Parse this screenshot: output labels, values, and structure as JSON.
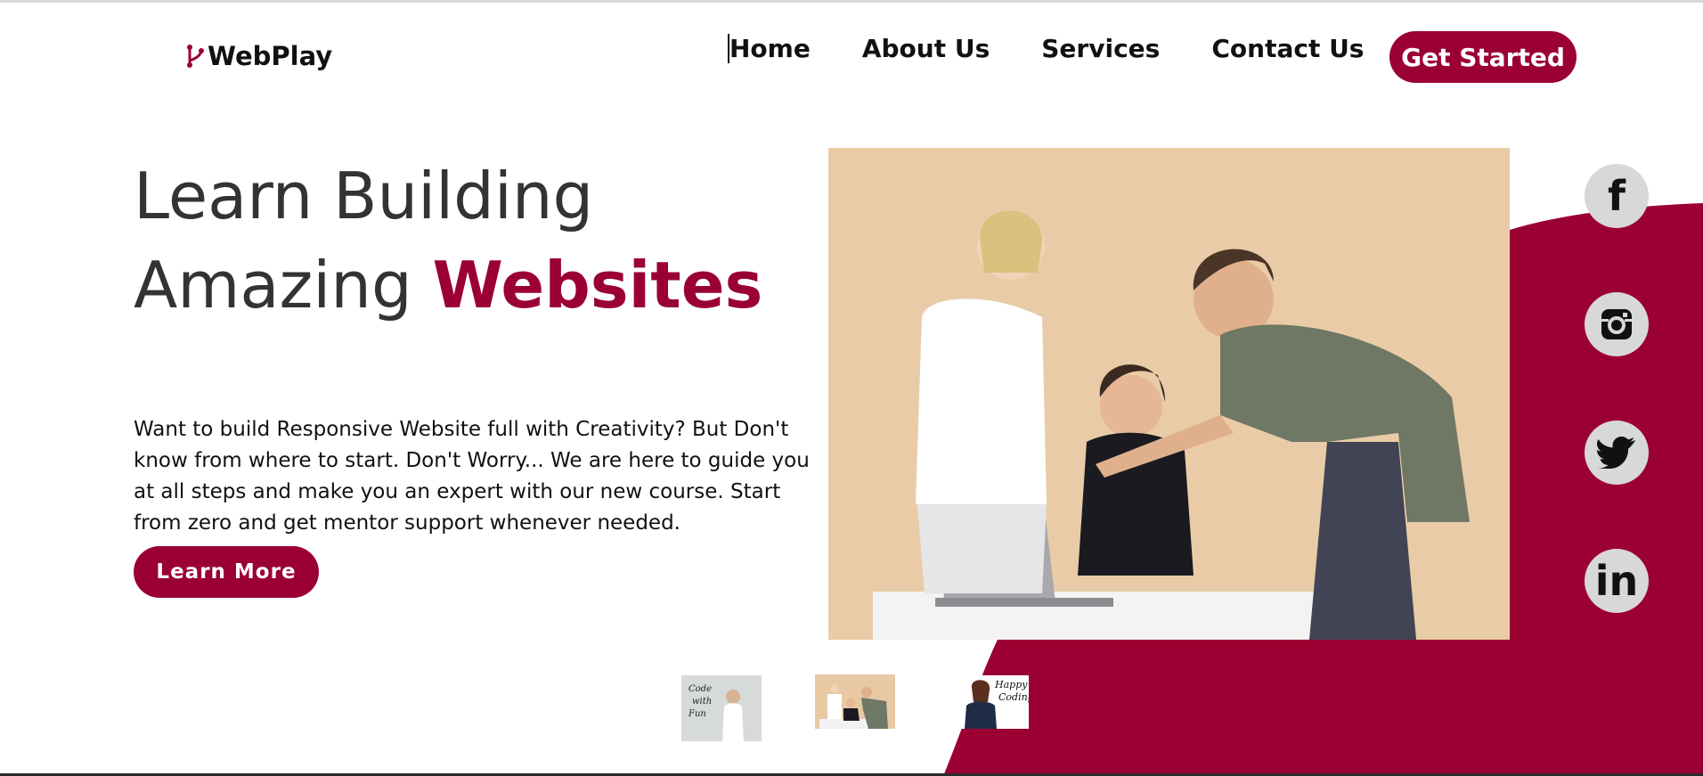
{
  "brand": {
    "name": "WebPlay",
    "accent": "#9b0033"
  },
  "nav": {
    "items": [
      {
        "label": "Home"
      },
      {
        "label": "About Us"
      },
      {
        "label": "Services"
      },
      {
        "label": "Contact Us"
      }
    ],
    "cta_label": "Get Started"
  },
  "hero": {
    "headline_line1": "Learn Building",
    "headline_line2_plain": "Amazing ",
    "headline_line2_accent": "Websites",
    "description": "Want to build Responsive Website full with Creativity? But Don't know from where to start. Don't Worry... We are here to guide you at all steps and make you an expert with our new course. Start from zero and get mentor support whenever needed.",
    "button_label": "Learn More"
  },
  "social": [
    {
      "icon": "facebook-icon",
      "glyph": "f"
    },
    {
      "icon": "instagram-icon",
      "glyph": ""
    },
    {
      "icon": "twitter-icon",
      "glyph": ""
    },
    {
      "icon": "linkedin-icon",
      "glyph": "in"
    }
  ],
  "thumbnails": [
    {
      "caption": "Code with Fun"
    },
    {
      "caption": ""
    },
    {
      "caption": "Happy Coding"
    }
  ]
}
